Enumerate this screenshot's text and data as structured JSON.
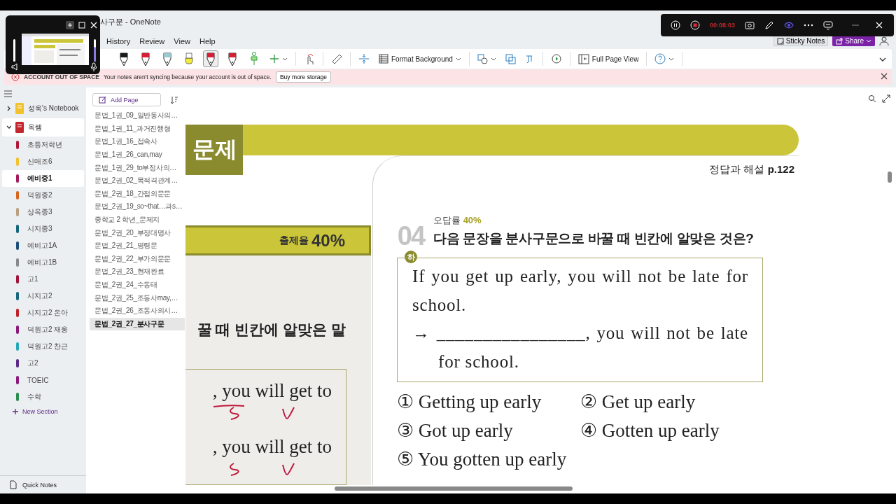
{
  "title_bar": {
    "title": "사구문 - OneNote"
  },
  "recorder_window": {
    "speaker": {
      "level": 1
    },
    "mic": {
      "level": 0.65
    }
  },
  "recording_toolbar": {
    "timer": "00:08:03"
  },
  "menu_tabs": [
    "History",
    "Review",
    "View",
    "Help"
  ],
  "account": {
    "sticky_notes": "Sticky Notes",
    "share": "Share"
  },
  "pens": [
    {
      "kind": "pen",
      "color": "#1a1a1a",
      "selected": false
    },
    {
      "kind": "pen",
      "color": "#d81e34",
      "selected": false
    },
    {
      "kind": "pen",
      "color": "#9cc8d0",
      "selected": false
    },
    {
      "kind": "highlighter",
      "color": "#f4ea3a",
      "selected": false
    },
    {
      "kind": "pen",
      "color": "#d81e34",
      "selected": true
    },
    {
      "kind": "pen",
      "color": "#d81e34",
      "selected": false
    }
  ],
  "ribbon": {
    "format_background": "Format Background",
    "full_page_view": "Full Page View"
  },
  "alert": {
    "title": "ACCOUNT OUT OF SPACE",
    "message": "Your notes aren't syncing because your account is out of space.",
    "action": "Buy more storage"
  },
  "notebooks": [
    {
      "name": "성욱's Notebook",
      "color": "#f2c12e",
      "expanded": false,
      "selected": false
    },
    {
      "name": "옥쌤",
      "color": "#c4262e",
      "expanded": true,
      "selected": true,
      "sections": [
        {
          "name": "초등저학년",
          "color": "#b0183a",
          "selected": false
        },
        {
          "name": "신매조6",
          "color": "#f2c12e",
          "selected": false
        },
        {
          "name": "예비중1",
          "color": "#a3195b",
          "selected": true
        },
        {
          "name": "덕원중2",
          "color": "#d9661f",
          "selected": false
        },
        {
          "name": "상옥중3",
          "color": "#b8a080",
          "selected": false
        },
        {
          "name": "시지중3",
          "color": "#17657d",
          "selected": false
        },
        {
          "name": "예비고1A",
          "color": "#1d4f7a",
          "selected": false
        },
        {
          "name": "예비고1B",
          "color": "#888888",
          "selected": false
        },
        {
          "name": "고1",
          "color": "#a0143c",
          "selected": false
        },
        {
          "name": "시지고2",
          "color": "#17657d",
          "selected": false
        },
        {
          "name": "시지고2 온아",
          "color": "#c0232c",
          "selected": false
        },
        {
          "name": "덕원고2 재웅",
          "color": "#8b1a7c",
          "selected": false
        },
        {
          "name": "덕원고2 찬근",
          "color": "#29a6b8",
          "selected": false
        },
        {
          "name": "고2",
          "color": "#5b2a86",
          "selected": false
        },
        {
          "name": "TOEIC",
          "color": "#8b1a7c",
          "selected": false
        },
        {
          "name": "수학",
          "color": "#2e8b4e",
          "selected": false
        }
      ]
    }
  ],
  "new_section": "New Section",
  "quick_notes": "Quick Notes",
  "pages": {
    "add_page": "Add Page",
    "items": [
      {
        "title": "문법_1권_09_일반동사의…",
        "selected": false
      },
      {
        "title": "문법_1권_11_과거진행형",
        "selected": false
      },
      {
        "title": "문법_1권_16_접속사",
        "selected": false
      },
      {
        "title": "문법_1권_26_can,may",
        "selected": false
      },
      {
        "title": "문법_1권_29_to부정사의…",
        "selected": false
      },
      {
        "title": "문법_2권_02_목적격관계…",
        "selected": false
      },
      {
        "title": "문법_2권_18_간접의문문",
        "selected": false
      },
      {
        "title": "문법_2권_19_so~that…과s…",
        "selected": false
      },
      {
        "title": "중학교 2 학년_문제지",
        "selected": false
      },
      {
        "title": "문법_2권_20_부정대명사",
        "selected": false
      },
      {
        "title": "문법_2권_21_명령문",
        "selected": false
      },
      {
        "title": "문법_2권_22_부가의문문",
        "selected": false
      },
      {
        "title": "문법_2권_23_현재완료",
        "selected": false
      },
      {
        "title": "문법_2권_24_수동태",
        "selected": false
      },
      {
        "title": "문법_2권_25_조동사may,…",
        "selected": false
      },
      {
        "title": "문법_2권_26_조동사의시…",
        "selected": false
      },
      {
        "title": "문법_2권_27_분사구문",
        "selected": true
      }
    ]
  },
  "page": {
    "header": "문제",
    "rate_label": "출제율",
    "rate": "40%",
    "left_question": "꿀 때 빈칸에 알맞은 말",
    "left_lines": [
      ", you will get to",
      ", you will get to"
    ],
    "answer_ref": "정답과 해설 **p.122**",
    "wrong_rate_label": "오답률",
    "wrong_rate": "40%",
    "number": "04",
    "difficulty": "하",
    "question": "다음 문장을 분사구문으로 바꿀 때 빈칸에 알맞은 것은?",
    "box_lines": [
      "If you get up early, you will not be late for school.",
      "→ ________________, you will not be late for school."
    ],
    "options": [
      {
        "mark": "①",
        "text": "Getting up early"
      },
      {
        "mark": "②",
        "text": "Get up early"
      },
      {
        "mark": "③",
        "text": "Got up early"
      },
      {
        "mark": "④",
        "text": "Gotten up early"
      },
      {
        "mark": "⑤",
        "text": "You gotten up early"
      }
    ]
  }
}
